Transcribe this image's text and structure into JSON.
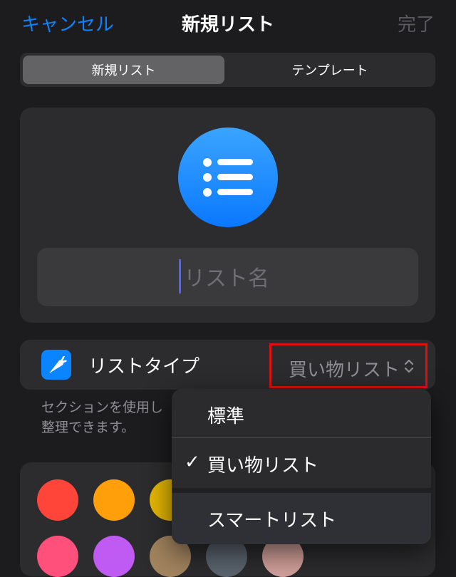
{
  "nav": {
    "cancel": "キャンセル",
    "title": "新規リスト",
    "done": "完了"
  },
  "segments": {
    "items": [
      "新規リスト",
      "テンプレート"
    ],
    "selected": "新規リスト"
  },
  "list_icon": {
    "icon": "list-bullet-icon",
    "color": "#0a84ff"
  },
  "name_field": {
    "placeholder": "リスト名",
    "value": ""
  },
  "list_type": {
    "icon": "carrot-icon",
    "label": "リストタイプ",
    "value": "買い物リスト",
    "chevron_icon": "chevron-up-down-icon"
  },
  "description": "セクションを使用し\n整理できます。",
  "colors": [
    "#ff453a",
    "#ff9f0a",
    "#e6b800",
    "#ff4f7b",
    "#bf5af2",
    "#a2845e",
    "#5b656f",
    "#d4a19b"
  ],
  "menu": {
    "items": [
      "標準",
      "買い物リスト",
      "スマートリスト"
    ],
    "checked": "買い物リスト",
    "check_icon": "checkmark-icon"
  }
}
